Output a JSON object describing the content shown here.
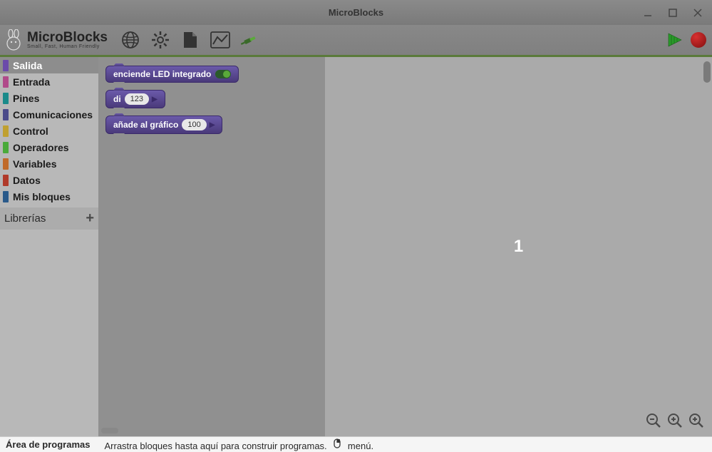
{
  "window": {
    "title": "MicroBlocks"
  },
  "logo": {
    "name": "MicroBlocks",
    "tagline": "Small, Fast, Human Friendly"
  },
  "categories": [
    {
      "label": "Salida",
      "color": "#6b4aaa",
      "active": true
    },
    {
      "label": "Entrada",
      "color": "#b04a8a"
    },
    {
      "label": "Pines",
      "color": "#1a8a8a"
    },
    {
      "label": "Comunicaciones",
      "color": "#4a4a8a"
    },
    {
      "label": "Control",
      "color": "#c0a030"
    },
    {
      "label": "Operadores",
      "color": "#4aaa3a"
    },
    {
      "label": "Variables",
      "color": "#c06a2a"
    },
    {
      "label": "Datos",
      "color": "#b03a2a"
    },
    {
      "label": "Mis bloques",
      "color": "#2a5a8a"
    }
  ],
  "libraries": {
    "label": "Librerías"
  },
  "blocks": {
    "led": {
      "label": "enciende LED integrado"
    },
    "say": {
      "label": "di",
      "value": "123"
    },
    "graph": {
      "label": "añade al gráfico",
      "value": "100"
    }
  },
  "canvas": {
    "value": "1"
  },
  "statusbar": {
    "title": "Área de programas",
    "hint_a": "Arrastra bloques hasta aquí para construir programas.",
    "hint_b": "menú."
  }
}
